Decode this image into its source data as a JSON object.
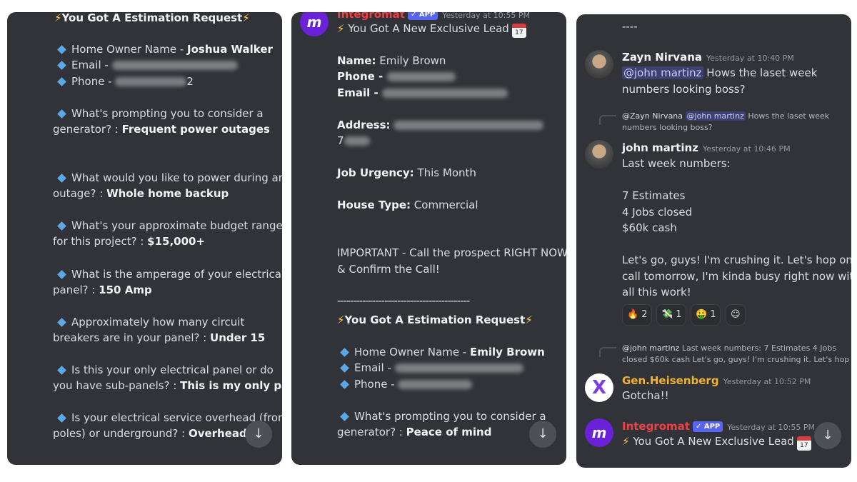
{
  "panel1": {
    "header": "You Got A Estimation Request",
    "bolt": "⚡",
    "home_owner_label": "Home Owner Name - ",
    "home_owner_value": "Joshua Walker",
    "email_label": "Email - ",
    "phone_label": "Phone - ",
    "phone_suffix": "2",
    "qa": [
      {
        "q1": "What's prompting you to consider a",
        "q2": "generator? : ",
        "a": "Frequent power outages"
      },
      {
        "q1": "What would you like to power during an",
        "q2": "outage? : ",
        "a": "Whole home backup"
      },
      {
        "q1": "What's your approximate budget range",
        "q2": "for this project?  : ",
        "a": "$15,000+"
      },
      {
        "q1": "What is the amperage of your electrical",
        "q2": "panel?  : ",
        "a": "150 Amp"
      },
      {
        "q1": "Approximately how many circuit",
        "q2": "breakers are in your panel?  : ",
        "a": "Under 15"
      },
      {
        "q1": "Is this your only electrical panel or do",
        "q2": "you have sub-panels?  : ",
        "a": "This is my only panel"
      },
      {
        "q1": "Is your electrical service overhead (from",
        "q2": "poles) or underground? : ",
        "a": "Overhead"
      }
    ],
    "scroll_icon": "↓"
  },
  "panel2": {
    "username": "Integromat",
    "app_badge": "✓ APP",
    "timestamp": "Yesterday at 10:55 PM",
    "lead_title": "You Got A New Exclusive Lead",
    "bolt": "⚡",
    "cal_text": "17",
    "name_label": "Name:",
    "name_value": "Emily  Brown",
    "phone_label": "Phone - ",
    "email_label": "Email - ",
    "address_label": "Address:",
    "address_line2": "7",
    "urgency_label": "Job Urgency:",
    "urgency_value": "This Month",
    "house_label": "House Type:",
    "house_value": "Commercial",
    "important_1": "IMPORTANT - Call the prospect RIGHT NOW",
    "important_2": "& Confirm the Call!",
    "divider": "------------------------------------------",
    "est_header": "You Got A Estimation Request",
    "home_owner_label": "Home Owner Name - ",
    "home_owner_value": "Emily  Brown",
    "q1": "What's prompting you to consider a",
    "q2": "generator? : ",
    "a": "Peace of mind",
    "scroll_icon": "↓"
  },
  "panel3": {
    "dashes": "----",
    "msg1": {
      "username": "Zayn Nirvana",
      "timestamp": "Yesterday at 10:40 PM",
      "mention": "@john martinz",
      "text1": " Hows the laset week",
      "text2": "numbers looking boss?"
    },
    "reply1": {
      "user": "@Zayn Nirvana",
      "mention": "@john martinz",
      "text1": " Hows the laset week",
      "text2": "numbers looking boss?"
    },
    "msg2": {
      "username": "john martinz",
      "timestamp": "Yesterday at 10:46 PM",
      "lines": [
        "Last week numbers:",
        "",
        "7 Estimates",
        "4 Jobs closed",
        "$60k cash",
        "",
        "Let's go, guys! I'm crushing it. Let's hop on a",
        "call tomorrow, I'm kinda busy right now with",
        "all this work!"
      ]
    },
    "reactions": [
      {
        "emoji": "🔥",
        "count": "2"
      },
      {
        "emoji": "💸",
        "count": "1"
      },
      {
        "emoji": "🤑",
        "count": "1"
      },
      {
        "emoji": "☺",
        "count": ""
      }
    ],
    "reply2": {
      "user": "@john martinz",
      "text1": " Last week numbers:  7 Estimates 4 Jobs",
      "text2": "closed $60k cash   Let's go, guys! I'm crushing it. Let's hop"
    },
    "msg3": {
      "username": "Gen.Heisenberg",
      "timestamp": "Yesterday at 10:52 PM",
      "text": "Gotcha!!",
      "avatar_letter": "X"
    },
    "msg4": {
      "username": "Integromat",
      "app_badge": "✓ APP",
      "timestamp": "Yesterday at 10:55 PM",
      "text": "You Got A New Exclusive Lead",
      "bolt": "⚡",
      "cal_text": "17",
      "avatar_letter": "m"
    },
    "scroll_icon": "↓"
  },
  "colors": {
    "bg": "#313338",
    "integromat_red": "#f23f43",
    "heisenberg_orange": "#f0b232",
    "app_badge": "#5865f2",
    "diamond": "#5aa9e6"
  }
}
